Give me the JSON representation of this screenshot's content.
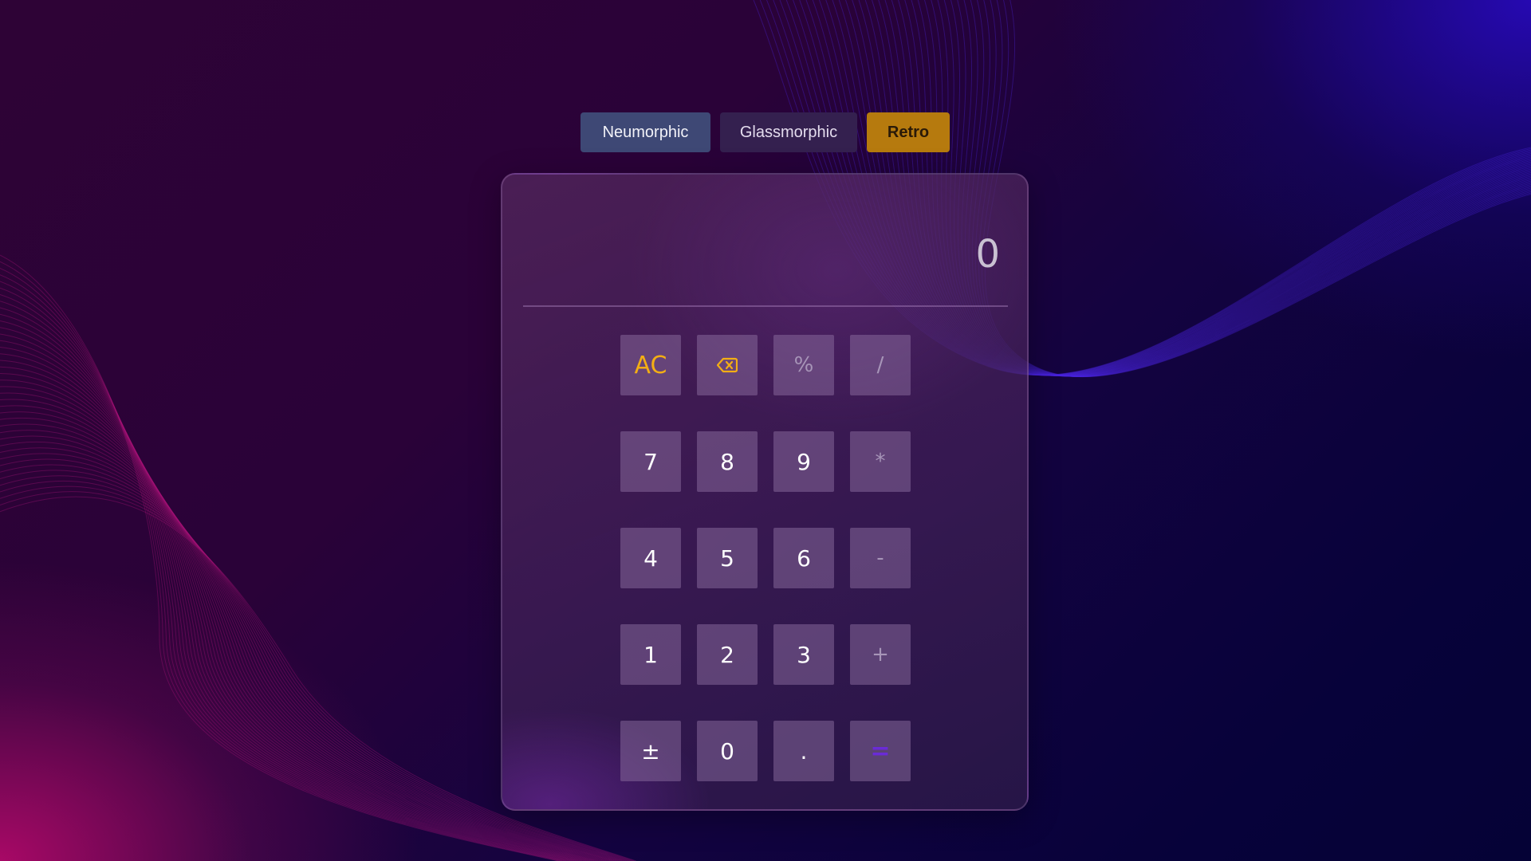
{
  "themes": {
    "neumorphic": "Neumorphic",
    "glassmorphic": "Glassmorphic",
    "retro": "Retro"
  },
  "display": {
    "value": "0"
  },
  "keys": {
    "ac": "AC",
    "backspace_icon": "backspace-icon",
    "percent": "%",
    "divide": "/",
    "seven": "7",
    "eight": "8",
    "nine": "9",
    "multiply": "*",
    "four": "4",
    "five": "5",
    "six": "6",
    "minus": "-",
    "one": "1",
    "two": "2",
    "three": "3",
    "plus": "+",
    "plusminus": "±",
    "zero": "0",
    "decimal": ".",
    "equals": "="
  },
  "colors": {
    "accent_ac": "#f3ae14",
    "equals": "#6a2bd6",
    "retro_button": "#b67a0e",
    "neumorphic_button": "#3e4875"
  }
}
